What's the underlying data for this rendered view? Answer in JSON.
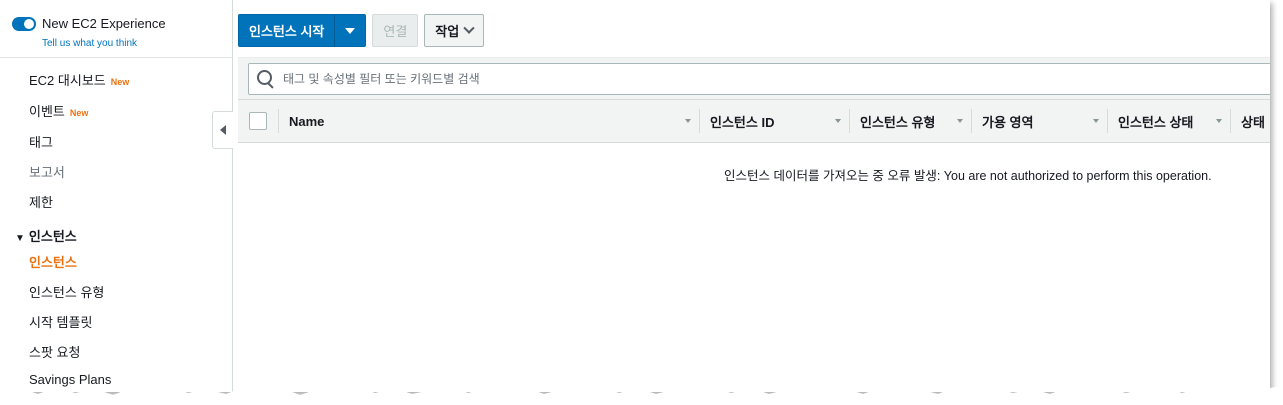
{
  "sidebar": {
    "experience_toggle_label": "New EC2 Experience",
    "feedback_link": "Tell us what you think",
    "items": [
      {
        "label": "EC2 대시보드",
        "badge": "New"
      },
      {
        "label": "이벤트",
        "badge": "New"
      },
      {
        "label": "태그"
      },
      {
        "label": "보고서"
      },
      {
        "label": "제한"
      }
    ],
    "section_title": "인스턴스",
    "section_items": [
      {
        "label": "인스턴스",
        "active": true
      },
      {
        "label": "인스턴스 유형"
      },
      {
        "label": "시작 템플릿"
      },
      {
        "label": "스팟 요청"
      },
      {
        "label": "Savings Plans"
      }
    ]
  },
  "toolbar": {
    "launch_label": "인스턴스 시작",
    "connect_label": "연결",
    "actions_label": "작업"
  },
  "search": {
    "placeholder": "태그 및 속성별 필터 또는 키워드별 검색"
  },
  "table": {
    "columns": [
      "Name",
      "인스턴스 ID",
      "인스턴스 유형",
      "가용 영역",
      "인스턴스 상태",
      "상태"
    ],
    "error_message": "인스턴스 데이터를 가져오는 중 오류 발생: You are not authorized to perform this operation."
  },
  "colors": {
    "accent": "#0073bb",
    "active_nav": "#ec7211",
    "badge": "#ec7211"
  }
}
